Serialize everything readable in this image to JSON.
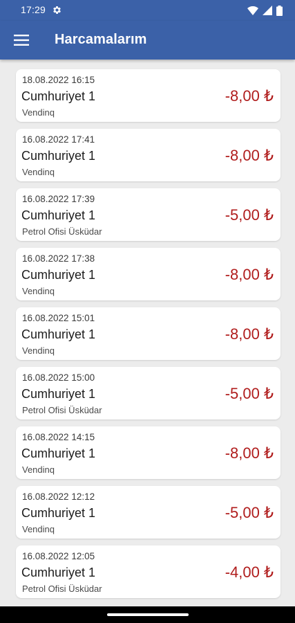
{
  "status_bar": {
    "time": "17:29",
    "icons": [
      "gear-icon",
      "wifi-icon",
      "signal-icon",
      "battery-icon"
    ]
  },
  "app_bar": {
    "menu_icon": "hamburger-menu-icon",
    "title": "Harcamalarım",
    "color": "#3b61a8"
  },
  "transactions": [
    {
      "date": "18.08.2022 16:15",
      "title": "Cumhuriyet 1",
      "location": "Vendinq",
      "amount": "-8,00 ₺"
    },
    {
      "date": "16.08.2022 17:41",
      "title": "Cumhuriyet 1",
      "location": "Vendinq",
      "amount": "-8,00 ₺"
    },
    {
      "date": "16.08.2022 17:39",
      "title": "Cumhuriyet 1",
      "location": "Petrol Ofisi Üsküdar",
      "amount": "-5,00 ₺"
    },
    {
      "date": "16.08.2022 17:38",
      "title": "Cumhuriyet 1",
      "location": "Vendinq",
      "amount": "-8,00 ₺"
    },
    {
      "date": "16.08.2022 15:01",
      "title": "Cumhuriyet 1",
      "location": "Vendinq",
      "amount": "-8,00 ₺"
    },
    {
      "date": "16.08.2022 15:00",
      "title": "Cumhuriyet 1",
      "location": "Petrol Ofisi Üsküdar",
      "amount": "-5,00 ₺"
    },
    {
      "date": "16.08.2022 14:15",
      "title": "Cumhuriyet 1",
      "location": "Vendinq",
      "amount": "-8,00 ₺"
    },
    {
      "date": "16.08.2022 12:12",
      "title": "Cumhuriyet 1",
      "location": "Vendinq",
      "amount": "-5,00 ₺"
    },
    {
      "date": "16.08.2022 12:05",
      "title": "Cumhuriyet 1",
      "location": "Petrol Ofisi Üsküdar",
      "amount": "-4,00 ₺"
    }
  ],
  "colors": {
    "amount": "#b01c1c",
    "background": "#ececec"
  }
}
